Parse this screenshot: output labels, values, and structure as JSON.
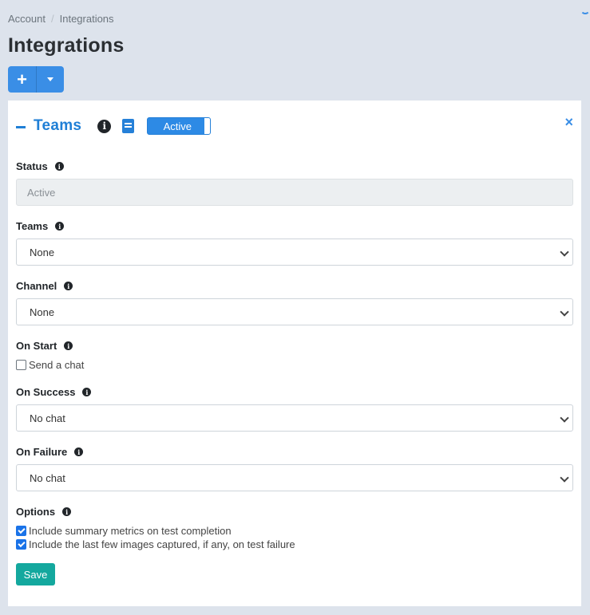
{
  "breadcrumb": {
    "items": [
      "Account",
      "Integrations"
    ],
    "separator": "/"
  },
  "page": {
    "title": "Integrations"
  },
  "toolbar": {
    "add_symbol": "+",
    "caret_icon": "caret-down"
  },
  "card": {
    "title": "Teams",
    "toggle_label": "Active",
    "close_symbol": "×",
    "info_symbol": "i",
    "fields": {
      "status": {
        "label": "Status",
        "value": "Active"
      },
      "teams": {
        "label": "Teams",
        "value": "None"
      },
      "channel": {
        "label": "Channel",
        "value": "None"
      },
      "on_start": {
        "label": "On Start",
        "checkbox_label": "Send a chat",
        "checked": false
      },
      "on_success": {
        "label": "On Success",
        "value": "No chat"
      },
      "on_failure": {
        "label": "On Failure",
        "value": "No chat"
      },
      "options": {
        "label": "Options",
        "items": [
          {
            "label": "Include summary metrics on test completion",
            "checked": true
          },
          {
            "label": "Include the last few images captured, if any, on test failure",
            "checked": true
          }
        ]
      }
    },
    "save_label": "Save"
  },
  "colors": {
    "accent": "#3a8ee6",
    "title_blue": "#1f7fd6",
    "save": "#14a89e",
    "background": "#dde3ec"
  }
}
